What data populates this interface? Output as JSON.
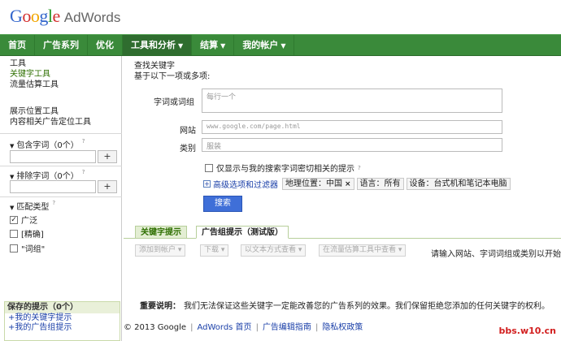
{
  "colors": {
    "nav_green": "#3a8a3a",
    "button_blue": "#3f6fd8",
    "link_blue": "#1a3fa8",
    "watermark_red": "#d21f1f"
  },
  "header": {
    "logo_letters": [
      {
        "ch": "G",
        "color": "#3366cc"
      },
      {
        "ch": "o",
        "color": "#d32f2f"
      },
      {
        "ch": "o",
        "color": "#f2a600"
      },
      {
        "ch": "g",
        "color": "#3366cc"
      },
      {
        "ch": "l",
        "color": "#2a9a2a"
      },
      {
        "ch": "e",
        "color": "#d32f2f"
      }
    ],
    "product": "AdWords"
  },
  "nav": {
    "home": "首页",
    "campaigns": "广告系列",
    "optimize": "优化",
    "tools": "工具和分析",
    "billing": "结算",
    "account": "我的帐户"
  },
  "sidebar": {
    "tools_heading": "工具",
    "keyword_tool": "关键字工具",
    "traffic_estimator": "流量估算工具",
    "placement_tool": "展示位置工具",
    "contextual_tool": "内容相关广告定位工具",
    "include_words": "包含字词（0个）",
    "exclude_words": "排除字词（0个）",
    "add_symbol": "+",
    "match_type": "匹配类型",
    "broad": "广泛",
    "exact": "[精确]",
    "phrase": "\"词组\"",
    "saved_title": "保存的提示（0个）",
    "saved_keywords": "我的关键字提示",
    "saved_adgroups": "我的广告组提示"
  },
  "main": {
    "find_keywords": "查找关键字",
    "based_on": "基于以下一项或多项:",
    "word_label": "字词或词组",
    "word_placeholder": "每行一个",
    "website_label": "网站",
    "website_placeholder": "www.google.com/page.html",
    "category_label": "类别",
    "category_placeholder": "服装",
    "only_closely": "仅显示与我的搜索字词密切相关的提示",
    "advanced": "高级选项和过滤器",
    "chip_location": "地理位置：中国",
    "chip_language": "语言：所有",
    "chip_device": "设备：台式机和笔记本电脑",
    "search_button": "搜索",
    "tab_keyword_ideas": "关键字提示",
    "tab_adgroup_ideas": "广告组提示（测试版）",
    "add_to_account": "添加到帐户",
    "download": "下载",
    "view_as_text": "以文本方式查看",
    "view_in_estimator": "在流量估算工具中查看",
    "hint": "请输入网站、字词词组或类别以开始",
    "notice_label": "重要说明：",
    "notice_text": "我们无法保证这些关键字一定能改善您的广告系列的效果。我们保留拒绝您添加的任何关键字的权利。"
  },
  "footer": {
    "copyright": "© 2013 Google",
    "adwords_home": "AdWords 首页",
    "editorial": "广告编辑指南",
    "privacy": "隐私权政策"
  },
  "watermark": "bbs.w10.cn"
}
